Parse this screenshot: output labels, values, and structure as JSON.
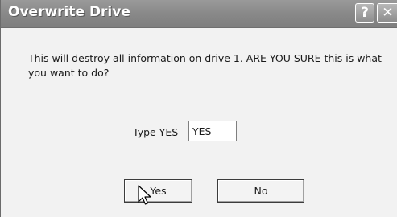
{
  "window": {
    "title": "Overwrite Drive",
    "help_glyph": "?",
    "close_glyph": "✕"
  },
  "dialog": {
    "message": "This will destroy all information on drive 1. ARE YOU SURE this is what you want to do?",
    "type_label": "Type YES",
    "type_value": "YES",
    "yes_label": "Yes",
    "no_label": "No"
  },
  "icons": {
    "help": "help-icon",
    "close": "close-icon",
    "cursor": "arrow-cursor-icon"
  }
}
